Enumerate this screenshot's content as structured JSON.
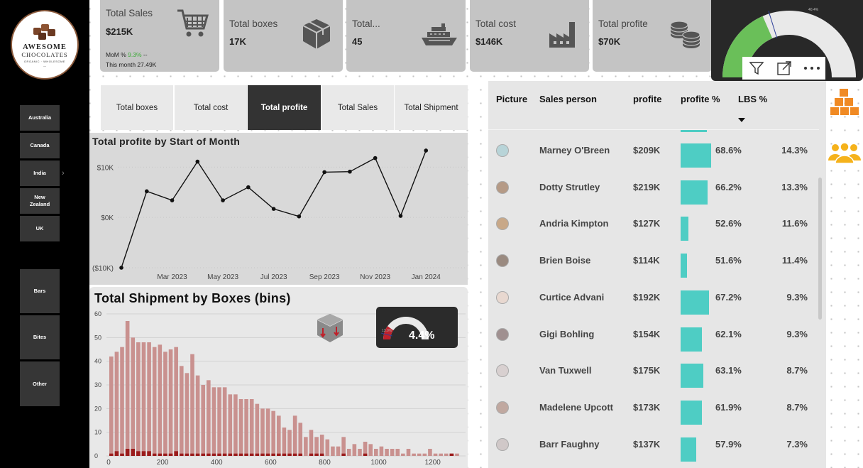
{
  "logo": {
    "line1": "AWESOME",
    "line2": "CHOCOLATES",
    "line3": "ORGANIC · WHOLESOME",
    "line4": "—"
  },
  "sidebar": {
    "geo": [
      {
        "label": "Australia"
      },
      {
        "label": "Canada"
      },
      {
        "label": "India"
      },
      {
        "label": "New Zealand"
      },
      {
        "label": "UK"
      }
    ],
    "categories": [
      {
        "label": "Bars"
      },
      {
        "label": "Bites"
      },
      {
        "label": "Other"
      }
    ]
  },
  "kpis": {
    "sales": {
      "label": "Total Sales",
      "value": "$215K",
      "mom_label": "MoM % ",
      "mom_value": "9.3%",
      "mom_suffix": " --",
      "month_label": "This month 27.49K"
    },
    "boxes": {
      "label": "Total boxes",
      "value": "17K"
    },
    "ship": {
      "label": "Total...",
      "value": "45"
    },
    "cost": {
      "label": "Total cost",
      "value": "$146K"
    },
    "profit": {
      "label": "Total profite",
      "value": "$70K"
    }
  },
  "gauge": {
    "top_label": "40.4%",
    "fill_fraction": 0.37,
    "target_fraction": 0.404
  },
  "toolbar": {
    "filter_icon": "filter-icon",
    "focus_icon": "focus-mode-icon",
    "more_icon": "more-options-icon"
  },
  "tabs": [
    {
      "label": "Total boxes",
      "active": false
    },
    {
      "label": "Total cost",
      "active": false
    },
    {
      "label": "Total profite",
      "active": true
    },
    {
      "label": "Total Sales",
      "active": false
    },
    {
      "label": "Total Shipment",
      "active": false
    }
  ],
  "colors": {
    "accent": "#4ecdc4",
    "gauge_green": "#6abf59",
    "hist_light": "#c9918f",
    "hist_dark": "#9b1c1c",
    "brand_orange": "#f08a24",
    "people_orange": "#f5b21b"
  },
  "chart_data": [
    {
      "type": "line",
      "title": "Total profite by Start of Month",
      "xlabel": "",
      "ylabel": "",
      "x": [
        "2023-01",
        "2023-02",
        "2023-03",
        "2023-04",
        "2023-05",
        "2023-06",
        "2023-07",
        "2023-08",
        "2023-09",
        "2023-10",
        "2023-11",
        "2023-12",
        "2024-01",
        "2024-02"
      ],
      "series": [
        {
          "values": [
            -10000,
            5200,
            3400,
            11100,
            3400,
            6000,
            1700,
            200,
            9000,
            9100,
            11800,
            300,
            13300
          ]
        }
      ],
      "y_ticks": [
        {
          "value": 10000,
          "label": "$10K"
        },
        {
          "value": 0,
          "label": "$0K"
        },
        {
          "value": -10000,
          "label": "($10K)"
        }
      ],
      "x_ticks": [
        {
          "x": "2023-03",
          "label": "Mar 2023"
        },
        {
          "x": "2023-05",
          "label": "May 2023"
        },
        {
          "x": "2023-07",
          "label": "Jul 2023"
        },
        {
          "x": "2023-09",
          "label": "Sep 2023"
        },
        {
          "x": "2023-11",
          "label": "Nov 2023"
        },
        {
          "x": "2024-01",
          "label": "Jan 2024"
        }
      ],
      "ylim": [
        -10000,
        14000
      ],
      "grid": true
    },
    {
      "type": "bar",
      "title": "Total Shipment by Boxes (bins)",
      "xlabel": "",
      "ylabel": "",
      "bin_width": 20,
      "x_start": 0,
      "x_ticks": [
        0,
        200,
        400,
        600,
        800,
        1000,
        1200
      ],
      "y_ticks": [
        0,
        10,
        20,
        30,
        40,
        50,
        60
      ],
      "xlim": [
        0,
        1290
      ],
      "ylim": [
        0,
        60
      ],
      "series": [
        {
          "values": [
            42,
            44,
            46,
            57,
            50,
            48,
            48,
            48,
            46,
            47,
            44,
            45,
            46,
            38,
            35,
            43,
            34,
            30,
            32,
            29,
            29,
            29,
            26,
            26,
            24,
            24,
            24,
            22,
            20,
            20,
            19,
            17,
            12,
            11,
            17,
            14,
            8,
            11,
            8,
            9,
            7,
            4,
            4,
            8,
            3,
            5,
            3,
            6,
            5,
            3,
            4,
            3,
            3,
            3,
            1,
            3,
            1,
            1,
            1,
            3,
            1,
            1,
            1,
            1,
            1
          ]
        },
        {
          "values": [
            1,
            2,
            1,
            3,
            3,
            2,
            2,
            2,
            1,
            1,
            1,
            1,
            2,
            1,
            1,
            1,
            1,
            1,
            1,
            1,
            1,
            1,
            1,
            1,
            1,
            1,
            1,
            1,
            1,
            1,
            1,
            1,
            1,
            1,
            1,
            1,
            0,
            1,
            1,
            1,
            0,
            0,
            0,
            1,
            0,
            0,
            0,
            1,
            0,
            0,
            0,
            0,
            0,
            0,
            0,
            0,
            0,
            0,
            0,
            0,
            0,
            0,
            0,
            1,
            0
          ]
        }
      ]
    }
  ],
  "mini_gauge": {
    "value": "4.4%",
    "min_label": "13.0%",
    "fill_fraction": 0.2
  },
  "table": {
    "headers": {
      "picture": "Picture",
      "sales_person": "Sales person",
      "profit": "profite",
      "profit_pct": "profite %",
      "lbs_pct": "LBS %"
    },
    "rows": [
      {
        "name": "Marney O'Breen",
        "profit": "$209K",
        "pct": "68.6%",
        "pct_value": 68.6,
        "lbs": "14.3%"
      },
      {
        "name": "Dotty Strutley",
        "profit": "$219K",
        "pct": "66.2%",
        "pct_value": 66.2,
        "lbs": "13.3%"
      },
      {
        "name": "Andria Kimpton",
        "profit": "$127K",
        "pct": "52.6%",
        "pct_value": 52.6,
        "lbs": "11.6%"
      },
      {
        "name": "Brien Boise",
        "profit": "$114K",
        "pct": "51.6%",
        "pct_value": 51.6,
        "lbs": "11.4%"
      },
      {
        "name": "Curtice Advani",
        "profit": "$192K",
        "pct": "67.2%",
        "pct_value": 67.2,
        "lbs": "9.3%"
      },
      {
        "name": "Gigi Bohling",
        "profit": "$154K",
        "pct": "62.1%",
        "pct_value": 62.1,
        "lbs": "9.3%"
      },
      {
        "name": "Van Tuxwell",
        "profit": "$175K",
        "pct": "63.1%",
        "pct_value": 63.1,
        "lbs": "8.7%"
      },
      {
        "name": "Madelene Upcott",
        "profit": "$173K",
        "pct": "61.9%",
        "pct_value": 61.9,
        "lbs": "8.7%"
      },
      {
        "name": "Barr Faughny",
        "profit": "$137K",
        "pct": "57.9%",
        "pct_value": 57.9,
        "lbs": "7.3%"
      }
    ]
  },
  "right_icons": {
    "boxes_icon": "stacked-boxes-icon",
    "people_icon": "people-group-icon"
  }
}
